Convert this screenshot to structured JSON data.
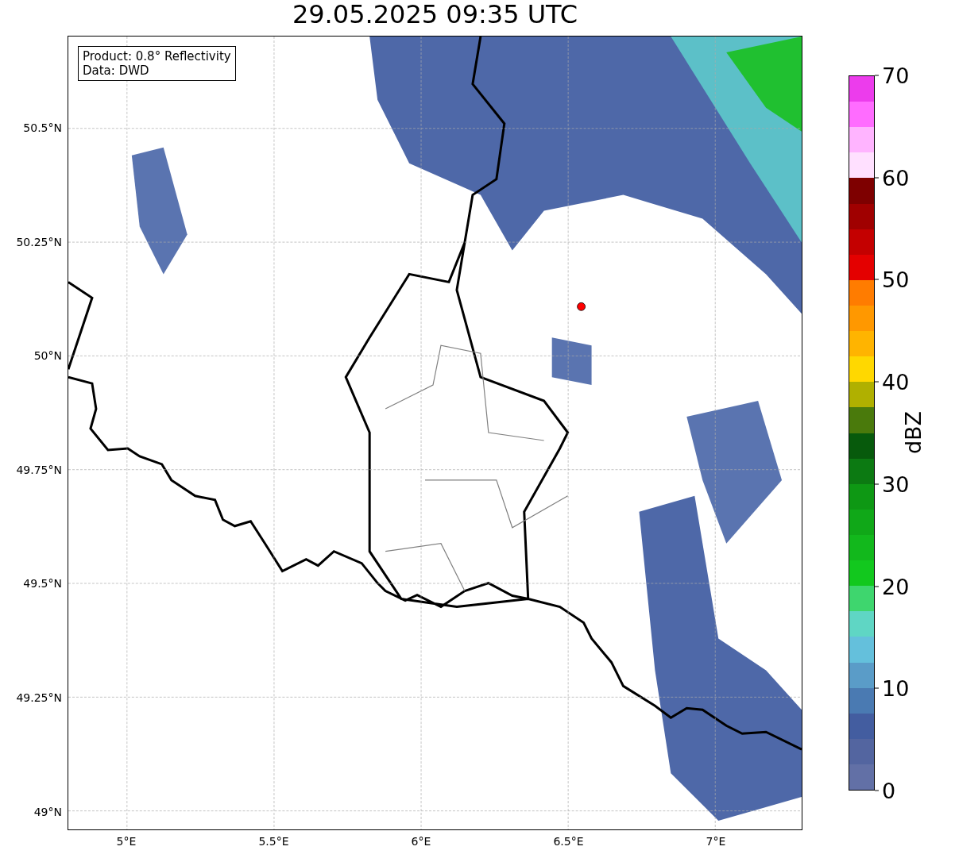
{
  "title": "29.05.2025 09:35 UTC",
  "info_box": [
    "Product: 0.8° Reflectivity",
    "Data: DWD"
  ],
  "map": {
    "y_labels": [
      "50.5°N",
      "50.25°N",
      "50°N",
      "49.75°N",
      "49.5°N",
      "49.25°N",
      "49°N"
    ],
    "x_labels": [
      "5°E",
      "5.5°E",
      "6°E",
      "6.5°E",
      "7°E"
    ]
  },
  "colorbar": {
    "label": "dBZ",
    "ticks": [
      "70",
      "60",
      "50",
      "40",
      "30",
      "20",
      "10",
      "0"
    ],
    "bins": [
      {
        "color": "#ec3cec"
      },
      {
        "color": "#ff6cff"
      },
      {
        "color": "#ffb4ff"
      },
      {
        "color": "#ffe0ff"
      },
      {
        "color": "#7e0000"
      },
      {
        "color": "#a00000"
      },
      {
        "color": "#c40000"
      },
      {
        "color": "#e40000"
      },
      {
        "color": "#ff7c00"
      },
      {
        "color": "#ff9800"
      },
      {
        "color": "#ffb400"
      },
      {
        "color": "#ffd800"
      },
      {
        "color": "#b0b000"
      },
      {
        "color": "#4a7a0c"
      },
      {
        "color": "#075a0c"
      },
      {
        "color": "#0c7a12"
      },
      {
        "color": "#0e9814"
      },
      {
        "color": "#10a818"
      },
      {
        "color": "#12b81c"
      },
      {
        "color": "#12c81e"
      },
      {
        "color": "#3ed66e"
      },
      {
        "color": "#5fd6c4"
      },
      {
        "color": "#64c0dc"
      },
      {
        "color": "#5a9cc8"
      },
      {
        "color": "#4a7ab2"
      },
      {
        "color": "#435da0"
      },
      {
        "color": "#5365a0"
      },
      {
        "color": "#6270a6"
      }
    ]
  }
}
